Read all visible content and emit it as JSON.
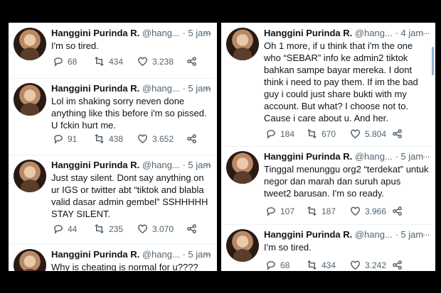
{
  "left_column": [
    {
      "name": "Hanggini Purinda R.",
      "handle": "@hang...",
      "time": "· 5 jam",
      "text": "I'm so tired.",
      "replies": "68",
      "retweets": "434",
      "likes": "3.238"
    },
    {
      "name": "Hanggini Purinda R.",
      "handle": "@hang...",
      "time": "· 5 jam",
      "text": "Lol im shaking sorry neven done anything like this before i'm so pissed. U fckin hurt me.",
      "replies": "91",
      "retweets": "438",
      "likes": "3.652"
    },
    {
      "name": "Hanggini Purinda R.",
      "handle": "@hang...",
      "time": "· 5 jam",
      "text": "Just stay silent. Dont say anything on ur IGS or twitter abt “tiktok and blabla valid dasar admin gembel” SSHHHHH STAY SILENT.",
      "replies": "44",
      "retweets": "235",
      "likes": "3.070"
    },
    {
      "name": "Hanggini Purinda R.",
      "handle": "@hang...",
      "time": "· 5 jam",
      "text": "Why is cheating is normal for u????",
      "replies": "",
      "retweets": "",
      "likes": ""
    }
  ],
  "right_column": [
    {
      "name": "Hanggini Purinda R.",
      "handle": "@hang...",
      "time": "· 4 jam",
      "text": "Oh 1 more, if u think that i'm the one who “SEBAR” info ke admin2 tiktok bahkan sampe bayar mereka. I dont think i need to pay them. If im the bad guy i could just share bukti with my account. But what? I choose not to. Cause i care about u. And her.",
      "replies": "184",
      "retweets": "670",
      "likes": "5.804"
    },
    {
      "name": "Hanggini Purinda R.",
      "handle": "@hang...",
      "time": "· 5 jam",
      "text": "Tinggal menunggu org2 “terdekat” untuk negor dan marah dan suruh apus tweet2 barusan. I'm so ready.",
      "replies": "107",
      "retweets": "187",
      "likes": "3.966"
    },
    {
      "name": "Hanggini Purinda R.",
      "handle": "@hang...",
      "time": "· 5 jam",
      "text": "I'm so tired.",
      "replies": "68",
      "retweets": "434",
      "likes": "3.242"
    }
  ],
  "icons": {
    "reply": "reply-icon",
    "retweet": "retweet-icon",
    "like": "heart-icon",
    "share": "share-icon",
    "more": "more-icon"
  },
  "colors": {
    "text": "#0f1419",
    "secondary": "#536471",
    "divider": "#eff3f4",
    "background": "#000000"
  }
}
